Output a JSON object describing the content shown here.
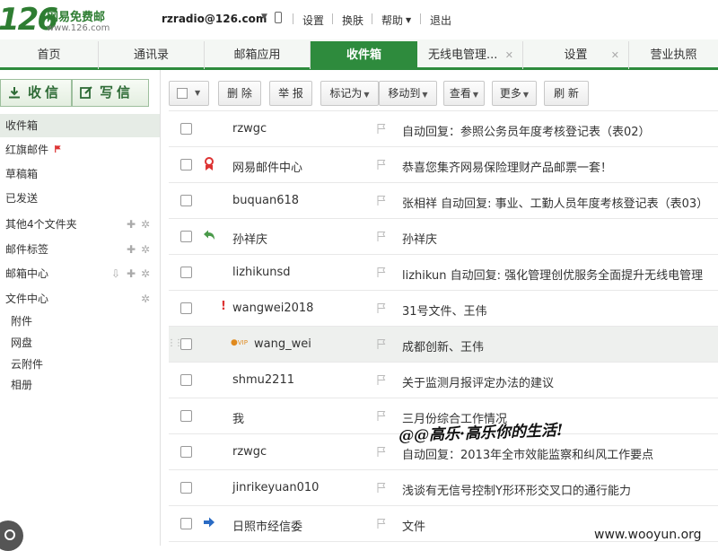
{
  "brand": {
    "logo_number": "126",
    "logo_name": "网易免费邮",
    "logo_url": "www.126.com"
  },
  "header": {
    "user": "rzradio@126.com",
    "links": [
      "设置",
      "换肤",
      "帮助",
      "退出"
    ]
  },
  "tabs": [
    {
      "label": "首页"
    },
    {
      "label": "通讯录"
    },
    {
      "label": "邮箱应用"
    },
    {
      "label": "收件箱",
      "active": true
    },
    {
      "label": "无线电管理...",
      "closable": true
    },
    {
      "label": "设置",
      "closable": true
    },
    {
      "label": "营业执照"
    }
  ],
  "sidebar": {
    "receive_label": "收信",
    "compose_label": "写信",
    "folders": [
      {
        "name": "收件箱",
        "current": true
      },
      {
        "name": "红旗邮件",
        "flag": true
      },
      {
        "name": "草稿箱"
      },
      {
        "name": "已发送"
      },
      {
        "name": "其他4个文件夹",
        "tools": [
          "add",
          "gear"
        ]
      },
      {
        "name": "邮件标签",
        "tools": [
          "add",
          "gear"
        ]
      },
      {
        "name": "邮箱中心",
        "tools": [
          "download",
          "add",
          "gear"
        ]
      },
      {
        "name": "文件中心",
        "tools": [
          "gear"
        ]
      },
      {
        "name": "附件",
        "sub": true
      },
      {
        "name": "网盘",
        "sub": true
      },
      {
        "name": "云附件",
        "sub": true
      },
      {
        "name": "相册",
        "sub": true
      }
    ]
  },
  "toolbar": {
    "delete": "删 除",
    "report": "举 报",
    "mark_as": "标记为",
    "move_to": "移动到",
    "view": "查看",
    "more": "更多",
    "refresh": "刷 新"
  },
  "mails": [
    {
      "sender": "rzwgc",
      "subject": "自动回复：参照公务员年度考核登记表（表02）"
    },
    {
      "sender": "网易邮件中心",
      "subject": "恭喜您集齐网易保险理财产品邮票一套！",
      "status": "badge-icon"
    },
    {
      "sender": "buquan618",
      "subject": "张相祥 自动回复: 事业、工勤人员年度考核登记表（表03）"
    },
    {
      "sender": "孙祥庆",
      "subject": "孙祥庆",
      "status": "replied-icon"
    },
    {
      "sender": "lizhikunsd",
      "subject": "lizhikun 自动回复: 强化管理创优服务全面提升无线电管理"
    },
    {
      "sender": "wangwei2018",
      "subject": "31号文件、王伟",
      "status": "important-icon"
    },
    {
      "sender": "wang_wei",
      "subject": "成都创新、王伟",
      "vip": true,
      "hover": true
    },
    {
      "sender": "shmu2211",
      "subject": "关于监测月报评定办法的建议"
    },
    {
      "sender": "我",
      "subject": "三月份综合工作情况"
    },
    {
      "sender": "rzwgc",
      "subject": "自动回复：2013年全市效能监察和纠风工作要点"
    },
    {
      "sender": "jinrikeyuan010",
      "subject": "浅谈有无信号控制Y形环形交叉口的通行能力"
    },
    {
      "sender": "日照市经信委",
      "subject": "文件",
      "status": "forward-icon"
    }
  ],
  "overlay": {
    "handwritten": "@@高乐·高乐你的生活!",
    "site": "www.wooyun.org"
  },
  "colors": {
    "brand_green": "#2e8b3d",
    "flag_red": "#d33"
  }
}
